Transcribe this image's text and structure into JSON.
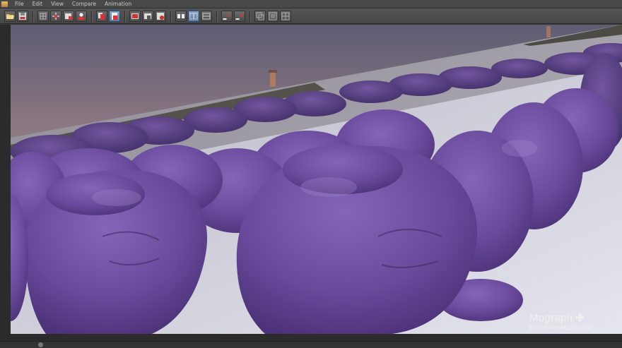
{
  "menubar": {
    "items": [
      "File",
      "Edit",
      "View",
      "Compare",
      "Animation"
    ]
  },
  "toolbar": {
    "buttons": [
      {
        "icon": "open-file-icon"
      },
      {
        "icon": "save-file-icon"
      },
      {
        "icon": "grid-icon"
      },
      {
        "icon": "target-icon"
      },
      {
        "icon": "render-region-icon"
      },
      {
        "icon": "user-icon"
      },
      {
        "icon": "copy-icon"
      },
      {
        "icon": "paste-icon"
      },
      {
        "icon": "snapshot-icon"
      },
      {
        "icon": "folder-icon"
      },
      {
        "icon": "gear-icon"
      },
      {
        "icon": "ab-compare-icon"
      },
      {
        "icon": "split-icon"
      },
      {
        "icon": "split-horizontal-icon"
      },
      {
        "icon": "set-a-icon"
      },
      {
        "icon": "set-b-icon"
      },
      {
        "icon": "layers-icon"
      },
      {
        "icon": "filter-icon"
      },
      {
        "icon": "settings-icon"
      }
    ],
    "set_a_label": "A",
    "set_b_label": "B"
  },
  "watermark": {
    "title": "Mograph",
    "subtitle_prefix": "MOGRAPH",
    "subtitle_bold": "PLUS",
    "subtitle_suffix": ".COM"
  },
  "colors": {
    "figure_purple": "#6a4a9a",
    "sky_top": "#5c5a72",
    "sky_horizon": "#e8a070",
    "floor": "#d8d8e2"
  }
}
